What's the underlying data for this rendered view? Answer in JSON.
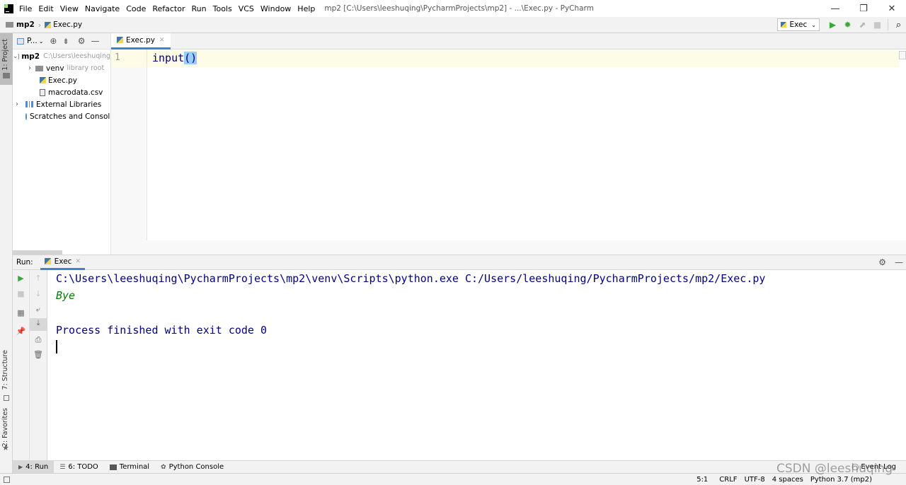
{
  "window": {
    "title": "mp2 [C:\\Users\\leeshuqing\\PycharmProjects\\mp2] - ...\\Exec.py - PyCharm",
    "menu": [
      "File",
      "Edit",
      "View",
      "Navigate",
      "Code",
      "Refactor",
      "Run",
      "Tools",
      "VCS",
      "Window",
      "Help"
    ],
    "controls": {
      "minimize": "—",
      "restore": "❐",
      "close": "✕"
    }
  },
  "navbar": {
    "breadcrumb": [
      "mp2",
      "Exec.py"
    ],
    "run_config": "Exec"
  },
  "left_stripe": {
    "project_tab": "1: Project",
    "structure_tab": "7: Structure",
    "favorites_tab": "2: Favorites"
  },
  "project_panel": {
    "header_label": "P...",
    "tree": [
      {
        "name": "mp2",
        "detail": "C:\\Users\\leeshuqing"
      },
      {
        "name": "venv",
        "detail": "library root"
      },
      {
        "name": "Exec.py",
        "detail": ""
      },
      {
        "name": "macrodata.csv",
        "detail": ""
      },
      {
        "name": "External Libraries",
        "detail": ""
      },
      {
        "name": "Scratches and Consoles",
        "detail": ""
      }
    ]
  },
  "editor": {
    "tab": "Exec.py",
    "line_number": "1",
    "code_fn": "input",
    "code_parens": "()"
  },
  "run_panel": {
    "label": "Run:",
    "tab": "Exec",
    "console": [
      "C:\\Users\\leeshuqing\\PycharmProjects\\mp2\\venv\\Scripts\\python.exe C:/Users/leeshuqing/PycharmProjects/mp2/Exec.py",
      "Bye",
      "Process finished with exit code 0"
    ]
  },
  "bottom_tabs": [
    {
      "label": "4: Run"
    },
    {
      "label": "6: TODO"
    },
    {
      "label": "Terminal"
    },
    {
      "label": "Python Console"
    }
  ],
  "event_log": "Event Log",
  "status": {
    "position": "5:1",
    "line_sep": "CRLF",
    "encoding": "UTF-8",
    "indent": "4 spaces",
    "interpreter": "Python 3.7 (mp2)"
  },
  "watermark": "CSDN @leeshuqing",
  "colors": {
    "accent": "#4083c9",
    "console_text": "#000080",
    "bye_text": "#0a7a0a",
    "run_green": "#39a839"
  }
}
